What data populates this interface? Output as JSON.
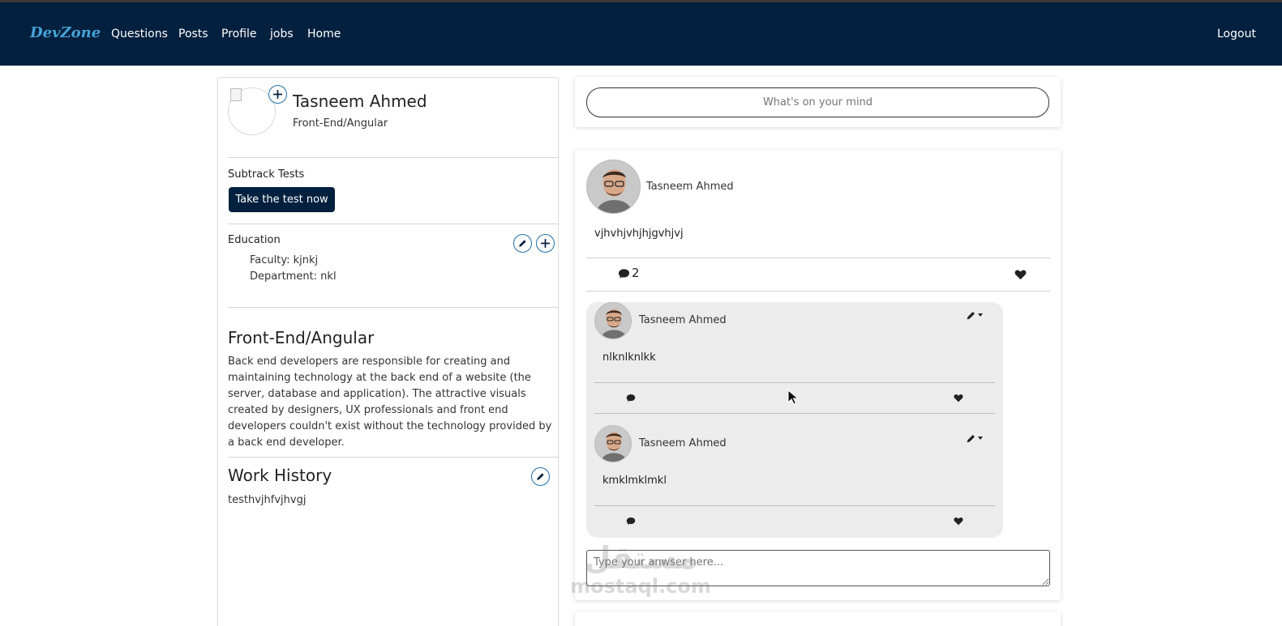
{
  "nav": {
    "brand": "DevZone",
    "links": [
      "Questions",
      "Posts",
      "Profile",
      "jobs",
      "Home"
    ],
    "logout": "Logout"
  },
  "profile": {
    "name": "Tasneem Ahmed",
    "track": "Front-End/Angular",
    "subtrack_label": "Subtrack Tests",
    "test_button": "Take the test now",
    "education": {
      "label": "Education",
      "faculty": "Faculty: kjnkj",
      "department": "Department: nkl"
    },
    "track_heading": "Front-End/Angular",
    "track_description": "Back end developers are responsible for creating and maintaining technology at the back end of a website (the server, database and application). The attractive visuals created by designers, UX professionals and front end developers couldn't exist without the technology provided by a back end developer.",
    "work_history": {
      "heading": "Work History",
      "text": "testhvjhfvjhvgj"
    }
  },
  "composer": {
    "placeholder": "What's on your mind"
  },
  "post": {
    "author": "Tasneem Ahmed",
    "body": "vjhvhjvhjhjgvhjvj",
    "comment_count": "2",
    "comments": [
      {
        "author": "Tasneem Ahmed",
        "body": "nlknlknlkk"
      },
      {
        "author": "Tasneem Ahmed",
        "body": "kmklmklmkl"
      }
    ],
    "answer_placeholder": "Type your anwser here..."
  },
  "watermark": {
    "arabic": "مستقل",
    "latin": "mostaql.com"
  },
  "colors": {
    "navbar": "#03203f",
    "brand": "#46a3d6",
    "button": "#03203f",
    "comment_bg": "#ececec"
  }
}
